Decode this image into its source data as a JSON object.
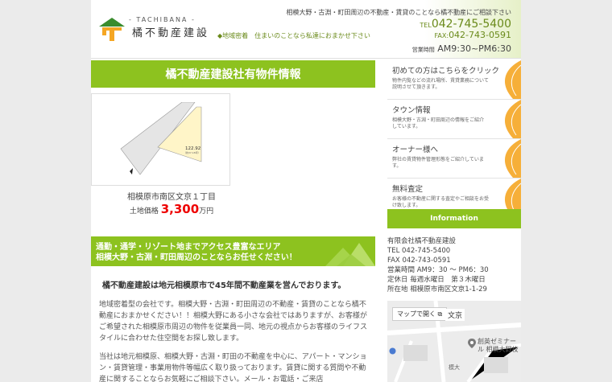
{
  "header": {
    "logo_en": "- TACHIBANA -",
    "logo_jp": "橘不動産建設",
    "tagline": "◆地域密着　住まいのことなら私達におまかせ下さい",
    "top_note": "相模大野・古淵・町田周辺の不動産・賃貸のことなら橘不動産にご相談下さい",
    "tel_label": "TEL",
    "tel": "042-745-5400",
    "fax_label": "FAX:",
    "fax": "042-743-0591",
    "hours_label": "営業時間",
    "hours": "AM9:30~PM6:30"
  },
  "main": {
    "title": "橘不動産建設社有物件情報",
    "property": {
      "plot_number": "122.92",
      "plot_sub": "（約37.18坪）",
      "address": "相模原市南区文京１丁目",
      "price_label": "土地価格",
      "price": "3,300",
      "price_unit": "万円"
    },
    "access_banner": {
      "line1": "通勤・通学・リゾート地までアクセス豊富なエリア",
      "line2": "相模大野・古淵・町田周辺のことならお任せください！"
    },
    "intro": {
      "heading": "橘不動産建設は地元相模原市で45年間不動産業を営んでおります。",
      "para1": "地域密着型の会社です。相模大野・古淵・町田周辺の不動産・賃貸のことなら橘不動産におまかせください！！相模大野にある小さな会社ではありますが、お客様がご希望された相模原市周辺の物件を従業員一同、地元の視点からお客様のライフスタイルに合わせた住空間をお探し致します。",
      "para2": "当社は地元相模原、相模大野・古淵・町田の不動産を中心に、アパート・マンション・賃貸管理・事業用物件等幅広く取り扱っております。賃貸に関する質問や不動産に関することならお気軽にご相談下さい。メール・お電話・ご来店"
    }
  },
  "sidebar": {
    "blocks": [
      {
        "title": "初めての方はこちらをクリック",
        "desc": "物件内覧などの流れ場所、賃貸業務について説明させて頂きます。"
      },
      {
        "title": "タウン情報",
        "desc": "相模大野・古淵・町田周辺の情報をご紹介しています。"
      },
      {
        "title": "オーナー様へ",
        "desc": "弊社の賃貸物件管理形態をご紹介しています。"
      },
      {
        "title": "無料査定",
        "desc": "お客様の不動産に関する査定やご相談をお受け致します。"
      }
    ],
    "info_title": "Information",
    "info_lines": [
      "有限会社橘不動産建設",
      "TEL 042-745-5400",
      "FAX 042-743-0591",
      "営業時間 AM9：30 ～ PM6：30",
      "定休日 毎週水曜日　第３木曜日",
      "所在地 相模原市南区文京1-1-29"
    ],
    "map": {
      "open_label": "マップで開く",
      "area_label": "文京",
      "pin_label": "創英ゼミナール 相模大野校",
      "side_label": "模大"
    }
  },
  "colors": {
    "accent": "#8dc21f",
    "price": "#e00000",
    "leaf": "#f5a623"
  }
}
